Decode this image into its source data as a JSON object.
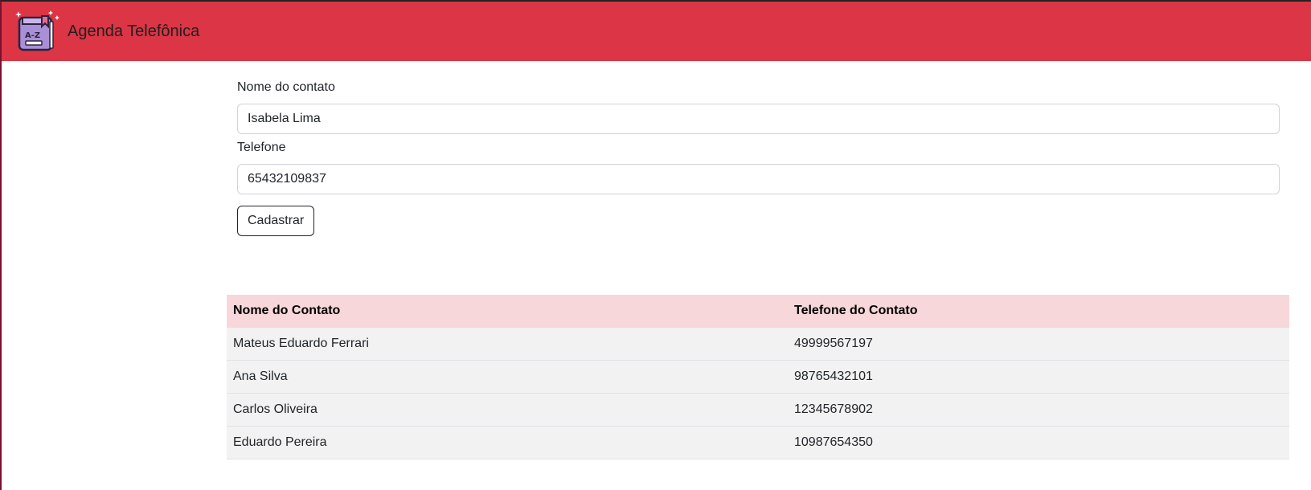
{
  "header": {
    "title": "Agenda Telefônica",
    "logo_text": "A-Z",
    "background_color": "#dc3545"
  },
  "form": {
    "name_label": "Nome do contato",
    "name_value": "Isabela Lima",
    "phone_label": "Telefone",
    "phone_value": "65432109837",
    "submit_label": "Cadastrar"
  },
  "table": {
    "headers": [
      "Nome do Contato",
      "Telefone do Contato"
    ],
    "rows": [
      [
        "Mateus Eduardo Ferrari",
        "49999567197"
      ],
      [
        "Ana Silva",
        "98765432101"
      ],
      [
        "Carlos Oliveira",
        "12345678902"
      ],
      [
        "Eduardo Pereira",
        "10987654350"
      ]
    ],
    "header_color": "#f8d7da",
    "row_color": "#f2f2f2"
  }
}
